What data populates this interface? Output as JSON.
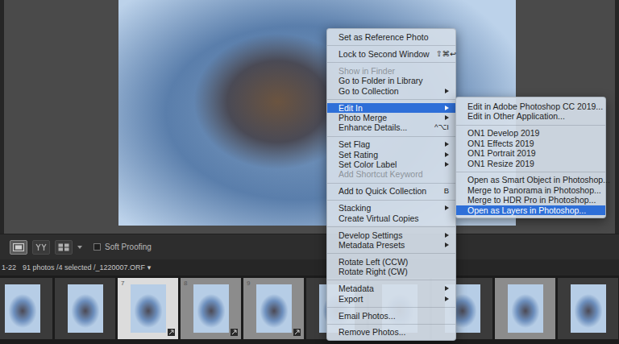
{
  "toolbar": {
    "views": [
      {
        "name": "loupe",
        "selected": true
      },
      {
        "name": "compare",
        "selected": false
      },
      {
        "name": "survey",
        "selected": false
      }
    ],
    "soft_proofing": {
      "label": "Soft Proofing",
      "checked": false
    }
  },
  "filmstrip_header": {
    "range": "1-22",
    "summary": "91 photos /4 selected /_1220007.ORF",
    "dropdown": "▾"
  },
  "filmstrip": [
    {
      "number": "",
      "selected": false,
      "active": false,
      "badge": false
    },
    {
      "number": "",
      "selected": false,
      "active": false,
      "badge": false
    },
    {
      "number": "7",
      "selected": true,
      "active": true,
      "badge": true
    },
    {
      "number": "8",
      "selected": true,
      "active": false,
      "badge": true
    },
    {
      "number": "9",
      "selected": true,
      "active": false,
      "badge": true
    },
    {
      "number": "",
      "selected": false,
      "active": false,
      "badge": false
    },
    {
      "number": "",
      "selected": false,
      "active": false,
      "badge": false
    },
    {
      "number": "",
      "selected": false,
      "active": false,
      "badge": false
    },
    {
      "number": "",
      "selected": true,
      "active": false,
      "badge": false
    },
    {
      "number": "",
      "selected": false,
      "active": false,
      "badge": false
    }
  ],
  "context_menu": {
    "items": [
      {
        "kind": "item",
        "label": "Set as Reference Photo",
        "shortcut": "",
        "disabled": false,
        "selected": false,
        "has_submenu": false
      },
      {
        "kind": "separator"
      },
      {
        "kind": "item",
        "label": "Lock to Second Window",
        "shortcut": "⇧⌘↩",
        "disabled": false,
        "selected": false,
        "has_submenu": false
      },
      {
        "kind": "separator"
      },
      {
        "kind": "item",
        "label": "Show in Finder",
        "shortcut": "",
        "disabled": true,
        "selected": false,
        "has_submenu": false
      },
      {
        "kind": "item",
        "label": "Go to Folder in Library",
        "shortcut": "",
        "disabled": false,
        "selected": false,
        "has_submenu": false
      },
      {
        "kind": "item",
        "label": "Go to Collection",
        "shortcut": "",
        "disabled": false,
        "selected": false,
        "has_submenu": true
      },
      {
        "kind": "separator"
      },
      {
        "kind": "item",
        "label": "Edit In",
        "shortcut": "",
        "disabled": false,
        "selected": true,
        "has_submenu": true
      },
      {
        "kind": "item",
        "label": "Photo Merge",
        "shortcut": "",
        "disabled": false,
        "selected": false,
        "has_submenu": true
      },
      {
        "kind": "item",
        "label": "Enhance Details...",
        "shortcut": "^⌥I",
        "disabled": false,
        "selected": false,
        "has_submenu": false
      },
      {
        "kind": "separator"
      },
      {
        "kind": "item",
        "label": "Set Flag",
        "shortcut": "",
        "disabled": false,
        "selected": false,
        "has_submenu": true
      },
      {
        "kind": "item",
        "label": "Set Rating",
        "shortcut": "",
        "disabled": false,
        "selected": false,
        "has_submenu": true
      },
      {
        "kind": "item",
        "label": "Set Color Label",
        "shortcut": "",
        "disabled": false,
        "selected": false,
        "has_submenu": true
      },
      {
        "kind": "item",
        "label": "Add Shortcut Keyword",
        "shortcut": "",
        "disabled": true,
        "selected": false,
        "has_submenu": false
      },
      {
        "kind": "separator"
      },
      {
        "kind": "item",
        "label": "Add to Quick Collection",
        "shortcut": "B",
        "disabled": false,
        "selected": false,
        "has_submenu": false
      },
      {
        "kind": "separator"
      },
      {
        "kind": "item",
        "label": "Stacking",
        "shortcut": "",
        "disabled": false,
        "selected": false,
        "has_submenu": true
      },
      {
        "kind": "item",
        "label": "Create Virtual Copies",
        "shortcut": "",
        "disabled": false,
        "selected": false,
        "has_submenu": false
      },
      {
        "kind": "separator"
      },
      {
        "kind": "item",
        "label": "Develop Settings",
        "shortcut": "",
        "disabled": false,
        "selected": false,
        "has_submenu": true
      },
      {
        "kind": "item",
        "label": "Metadata Presets",
        "shortcut": "",
        "disabled": false,
        "selected": false,
        "has_submenu": true
      },
      {
        "kind": "separator"
      },
      {
        "kind": "item",
        "label": "Rotate Left (CCW)",
        "shortcut": "",
        "disabled": false,
        "selected": false,
        "has_submenu": false
      },
      {
        "kind": "item",
        "label": "Rotate Right (CW)",
        "shortcut": "",
        "disabled": false,
        "selected": false,
        "has_submenu": false
      },
      {
        "kind": "separator"
      },
      {
        "kind": "item",
        "label": "Metadata",
        "shortcut": "",
        "disabled": false,
        "selected": false,
        "has_submenu": true
      },
      {
        "kind": "item",
        "label": "Export",
        "shortcut": "",
        "disabled": false,
        "selected": false,
        "has_submenu": true
      },
      {
        "kind": "separator"
      },
      {
        "kind": "item",
        "label": "Email Photos...",
        "shortcut": "",
        "disabled": false,
        "selected": false,
        "has_submenu": false
      },
      {
        "kind": "separator"
      },
      {
        "kind": "item",
        "label": "Remove Photos...",
        "shortcut": "",
        "disabled": false,
        "selected": false,
        "has_submenu": false
      }
    ]
  },
  "submenu": {
    "items": [
      {
        "kind": "item",
        "label": "Edit in Adobe Photoshop CC 2019...",
        "selected": false
      },
      {
        "kind": "item",
        "label": "Edit in Other Application...",
        "selected": false
      },
      {
        "kind": "separator"
      },
      {
        "kind": "item",
        "label": "ON1 Develop 2019",
        "selected": false
      },
      {
        "kind": "item",
        "label": "ON1 Effects 2019",
        "selected": false
      },
      {
        "kind": "item",
        "label": "ON1 Portrait 2019",
        "selected": false
      },
      {
        "kind": "item",
        "label": "ON1 Resize 2019",
        "selected": false
      },
      {
        "kind": "separator"
      },
      {
        "kind": "item",
        "label": "Open as Smart Object in Photoshop...",
        "selected": false
      },
      {
        "kind": "item",
        "label": "Merge to Panorama in Photoshop...",
        "selected": false
      },
      {
        "kind": "item",
        "label": "Merge to HDR Pro in Photoshop...",
        "selected": false
      },
      {
        "kind": "item",
        "label": "Open as Layers in Photoshop...",
        "selected": true
      }
    ]
  }
}
